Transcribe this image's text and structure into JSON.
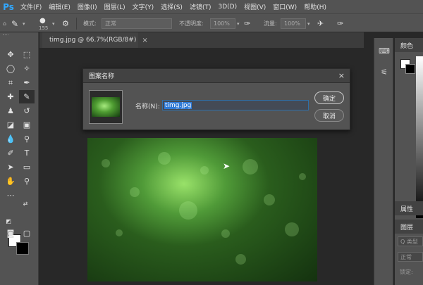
{
  "app": {
    "logo": "Ps"
  },
  "menubar": {
    "items": [
      "文件(F)",
      "编辑(E)",
      "图像(I)",
      "图层(L)",
      "文字(Y)",
      "选择(S)",
      "滤镜(T)",
      "3D(D)",
      "视图(V)",
      "窗口(W)",
      "帮助(H)"
    ]
  },
  "options": {
    "brush_size": "155",
    "mode_label": "模式:",
    "mode_value": "正常",
    "opacity_label": "不透明度:",
    "opacity_value": "100%",
    "flow_label": "流量:",
    "flow_value": "100%"
  },
  "document": {
    "tab_title": "timg.jpg @ 66.7%(RGB/8#)",
    "tab_close": "×"
  },
  "dialog": {
    "title": "图案名称",
    "close": "×",
    "name_label": "名称(N):",
    "name_value": "timg.jpg",
    "ok_label": "确定",
    "cancel_label": "取消"
  },
  "panels": {
    "color_tab": "颜色",
    "properties_tab": "属性",
    "layers_tab": "图层",
    "layers_kind": "Q 类型",
    "layers_mode": "正常",
    "layers_lock": "锁定:"
  },
  "colors": {
    "foreground": "#ffffff",
    "background": "#000000",
    "accent": "#31a8ff",
    "selection": "#2f7ad6"
  }
}
